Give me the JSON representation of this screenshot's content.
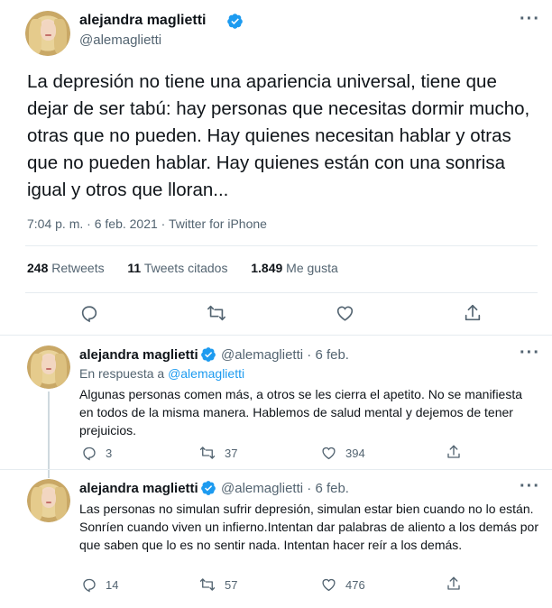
{
  "main_tweet": {
    "author_name": "alejandra maglietti",
    "author_handle": "@alemaglietti",
    "text": "La depresión no tiene una apariencia universal, tiene que dejar de ser tabú: hay personas que necesitas dormir mucho, otras que no pueden. Hay quienes necesitan hablar y otras que no pueden hablar. Hay quienes están con una sonrisa igual y otros que lloran...",
    "time": "7:04 p. m.",
    "date": "6 feb. 2021",
    "source": "Twitter for iPhone",
    "more_label": "···",
    "stats": {
      "retweets_count": "248",
      "retweets_label": "Retweets",
      "quotes_count": "11",
      "quotes_label": "Tweets citados",
      "likes_count": "1.849",
      "likes_label": "Me gusta"
    }
  },
  "replies": [
    {
      "author_name": "alejandra maglietti",
      "author_handle": "@alemaglietti",
      "date": "· 6 feb.",
      "reply_prefix": "En respuesta a",
      "reply_to": "@alemaglietti",
      "text": "Algunas personas comen más, a otros se les cierra el apetito. No se manifiesta en todos de la misma manera. Hablemos de salud mental y dejemos de tener prejuicios.",
      "replies": "3",
      "retweets": "37",
      "likes": "394",
      "more_label": "···"
    },
    {
      "author_name": "alejandra maglietti",
      "author_handle": "@alemaglietti",
      "date": "· 6 feb.",
      "text": "Las personas no simulan sufrir depresión, simulan estar bien cuando no lo están. Sonríen cuando viven un infierno.Intentan dar palabras de aliento a los demás por que saben que lo es no sentir nada. Intentan hacer reír a los demás.",
      "replies": "14",
      "retweets": "57",
      "likes": "476",
      "more_label": "···"
    }
  ],
  "colors": {
    "accent": "#1d9bf0",
    "text": "#0f1419",
    "secondary": "#536471",
    "divider": "#e6ecf0"
  }
}
